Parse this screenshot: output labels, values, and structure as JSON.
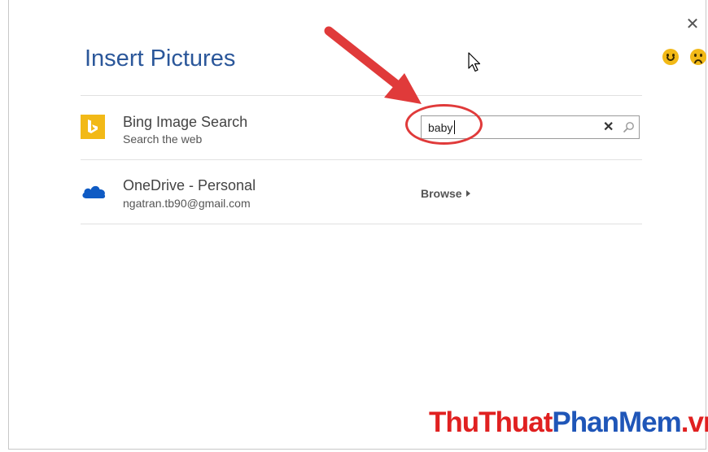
{
  "dialog": {
    "title": "Insert Pictures",
    "close_symbol": "✕",
    "feedback": {
      "smile_icon": "smile-icon",
      "frown_icon": "frown-icon"
    }
  },
  "sources": {
    "bing": {
      "title": "Bing Image Search",
      "subtitle": "Search the web",
      "icon": "bing-logo-icon",
      "search_value": "baby",
      "clear_symbol": "✕",
      "search_icon": "search-icon"
    },
    "onedrive": {
      "title": "OneDrive - Personal",
      "subtitle": "ngatran.tb90@gmail.com",
      "icon": "onedrive-cloud-icon",
      "browse_label": "Browse"
    }
  },
  "annotation": {
    "arrow_color": "#e03a3a",
    "ellipse_color": "#e03a3a"
  },
  "watermark": {
    "part1": "ThuThuat",
    "part2": "PhanMem",
    "part3": ".vn"
  },
  "colors": {
    "title": "#2b579a",
    "bing_yellow": "#f2b917",
    "onedrive_blue": "#0f5bc4"
  }
}
